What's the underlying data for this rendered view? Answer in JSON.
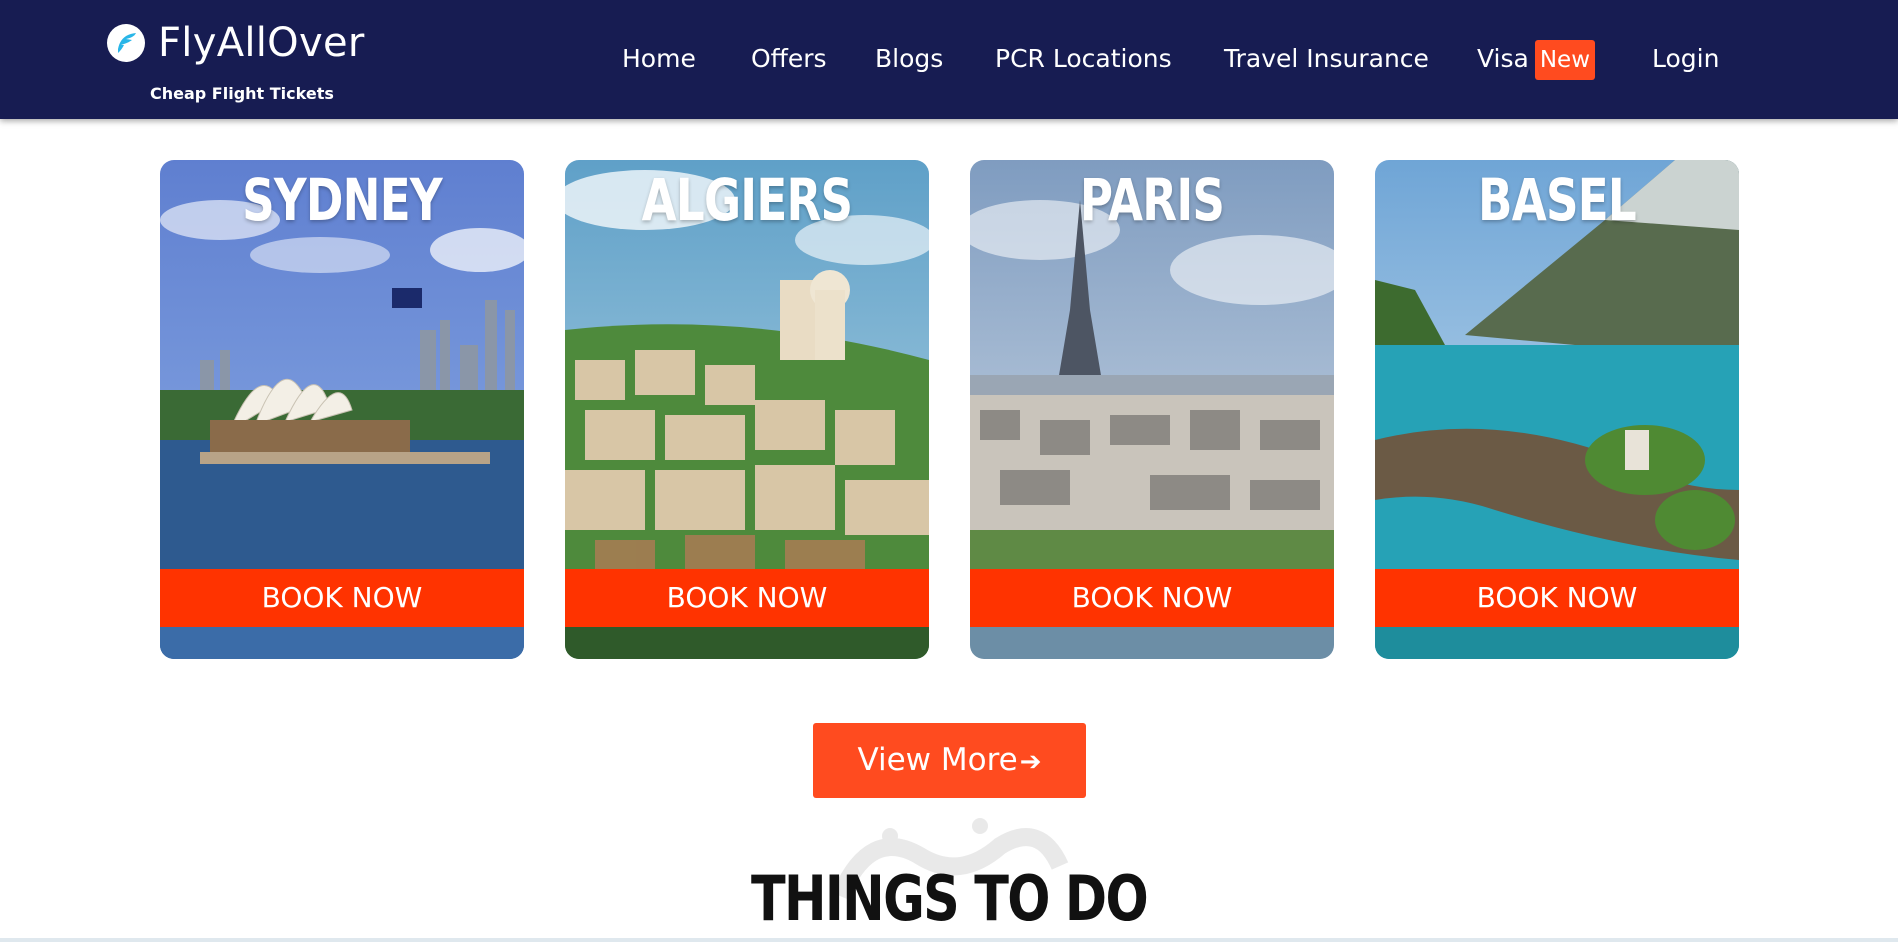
{
  "header": {
    "brand": "FlyAllOver",
    "tagline": "Cheap Flight Tickets",
    "nav": [
      {
        "label": "Home"
      },
      {
        "label": "Offers"
      },
      {
        "label": "Blogs"
      },
      {
        "label": "PCR Locations"
      },
      {
        "label": "Travel Insurance"
      },
      {
        "label": "Visa",
        "badge": "New"
      },
      {
        "label": "Login"
      }
    ]
  },
  "destinations": [
    {
      "city": "SYDNEY",
      "button": "BOOK NOW"
    },
    {
      "city": "ALGIERS",
      "button": "BOOK NOW"
    },
    {
      "city": "PARIS",
      "button": "BOOK NOW"
    },
    {
      "city": "BASEL",
      "button": "BOOK NOW"
    }
  ],
  "view_more": {
    "label": "View More",
    "icon": "arrow-right-icon"
  },
  "section": {
    "title": "THINGS TO DO"
  },
  "colors": {
    "header_bg": "#171c52",
    "accent": "#ff3300",
    "button": "#ff4b1f",
    "badge": "#ff4b1f"
  }
}
